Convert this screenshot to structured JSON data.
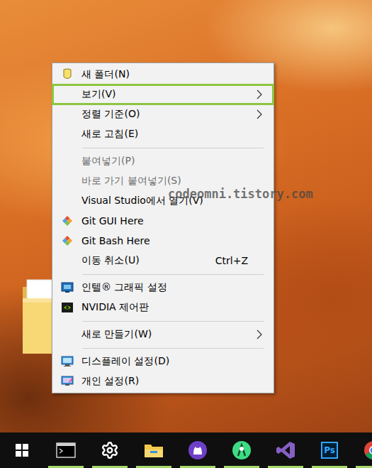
{
  "context_menu": {
    "groups": [
      {
        "items": [
          {
            "label": "새 폴더(N)",
            "kind": "icon",
            "shortcut": "",
            "submenu": false,
            "disabled": false,
            "highlighted": false
          },
          {
            "label": "보기(V)",
            "kind": "text",
            "shortcut": "",
            "submenu": true,
            "disabled": false,
            "highlighted": true
          },
          {
            "label": "정렬 기준(O)",
            "kind": "text",
            "shortcut": "",
            "submenu": true,
            "disabled": false,
            "highlighted": false
          },
          {
            "label": "새로 고침(E)",
            "kind": "text",
            "shortcut": "",
            "submenu": false,
            "disabled": false,
            "highlighted": false
          }
        ]
      },
      {
        "items": [
          {
            "label": "붙여넣기(P)",
            "kind": "text",
            "shortcut": "",
            "submenu": false,
            "disabled": true,
            "highlighted": false
          },
          {
            "label": "바로 가기 붙여넣기(S)",
            "kind": "text",
            "shortcut": "",
            "submenu": false,
            "disabled": true,
            "highlighted": false
          },
          {
            "label": "Visual Studio에서 열기(V)",
            "kind": "text",
            "shortcut": "",
            "submenu": false,
            "disabled": false,
            "highlighted": false
          },
          {
            "label": "Git GUI Here",
            "kind": "icon",
            "shortcut": "",
            "submenu": false,
            "disabled": false,
            "highlighted": false
          },
          {
            "label": "Git Bash Here",
            "kind": "icon",
            "shortcut": "",
            "submenu": false,
            "disabled": false,
            "highlighted": false
          },
          {
            "label": "이동 취소(U)",
            "kind": "text",
            "shortcut": "Ctrl+Z",
            "submenu": false,
            "disabled": false,
            "highlighted": false
          }
        ]
      },
      {
        "items": [
          {
            "label": "인텔® 그래픽 설정",
            "kind": "icon",
            "shortcut": "",
            "submenu": false,
            "disabled": false,
            "highlighted": false
          },
          {
            "label": "NVIDIA 제어판",
            "kind": "icon",
            "shortcut": "",
            "submenu": false,
            "disabled": false,
            "highlighted": false
          }
        ]
      },
      {
        "items": [
          {
            "label": "새로 만들기(W)",
            "kind": "text",
            "shortcut": "",
            "submenu": true,
            "disabled": false,
            "highlighted": false
          }
        ]
      },
      {
        "items": [
          {
            "label": "디스플레이 설정(D)",
            "kind": "icon",
            "shortcut": "",
            "submenu": false,
            "disabled": false,
            "highlighted": false
          },
          {
            "label": "개인 설정(R)",
            "kind": "icon",
            "shortcut": "",
            "submenu": false,
            "disabled": false,
            "highlighted": false
          }
        ]
      }
    ]
  },
  "watermark": "codeomni.tistory.com",
  "taskbar": {
    "buttons": [
      {
        "text": "",
        "running": false
      },
      {
        "text": "",
        "running": true
      },
      {
        "text": "",
        "running": true
      },
      {
        "text": "",
        "running": true
      },
      {
        "text": "",
        "running": true
      },
      {
        "text": "",
        "running": true
      },
      {
        "text": "",
        "running": true
      },
      {
        "text": "Ps",
        "running": true
      },
      {
        "text": "",
        "running": true
      }
    ]
  }
}
